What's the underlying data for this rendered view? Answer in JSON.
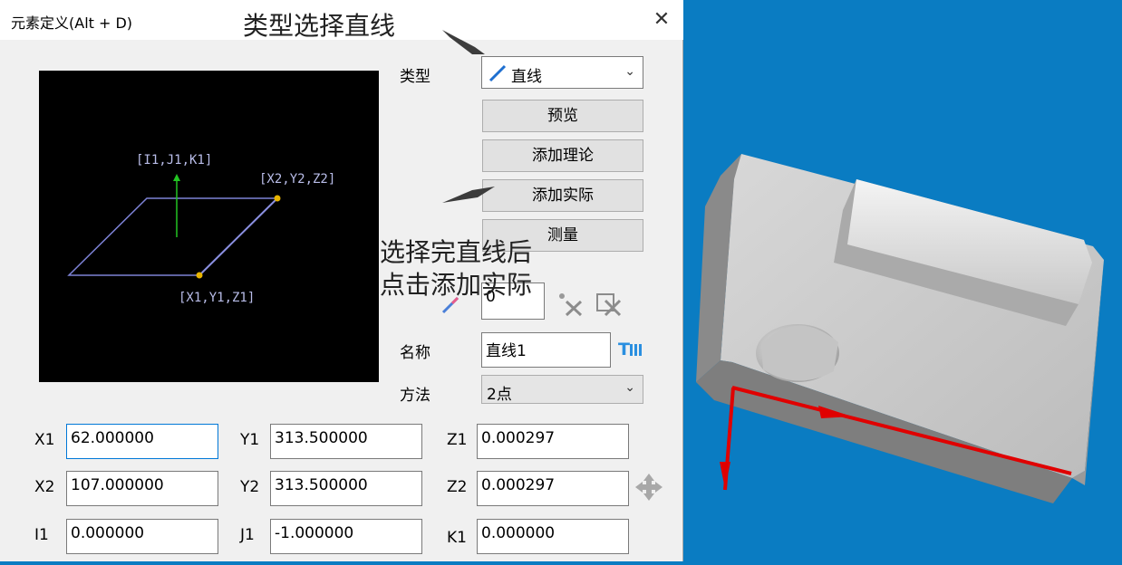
{
  "window": {
    "title": "元素定义(Alt + D)"
  },
  "preview": {
    "label_ijk": "[I1,J1,K1]",
    "label_p2": "[X2,Y2,Z2]",
    "label_p1": "[X1,Y1,Z1]"
  },
  "form": {
    "type_label": "类型",
    "type_value": "直线",
    "buttons": {
      "preview": "预览",
      "add_theory": "添加理论",
      "add_actual": "添加实际",
      "measure": "测量"
    },
    "count_value": "0",
    "name_label": "名称",
    "name_value": "直线1",
    "method_label": "方法",
    "method_value": "2点"
  },
  "coords": {
    "x1": {
      "label": "X1",
      "value": "62.000000"
    },
    "y1": {
      "label": "Y1",
      "value": "313.500000"
    },
    "z1": {
      "label": "Z1",
      "value": "0.000297"
    },
    "x2": {
      "label": "X2",
      "value": "107.000000"
    },
    "y2": {
      "label": "Y2",
      "value": "313.500000"
    },
    "z2": {
      "label": "Z2",
      "value": "0.000297"
    },
    "i1": {
      "label": "I1",
      "value": "0.000000"
    },
    "j1": {
      "label": "J1",
      "value": "-1.000000"
    },
    "k1": {
      "label": "K1",
      "value": "0.000000"
    }
  },
  "annotations": {
    "top": "类型选择直线",
    "mid_line1": "选择完直线后",
    "mid_line2": "点击添加实际"
  },
  "colors": {
    "viewport_bg": "#0a7cc2",
    "axis_red": "#e00000",
    "focus_border": "#0078d7"
  }
}
